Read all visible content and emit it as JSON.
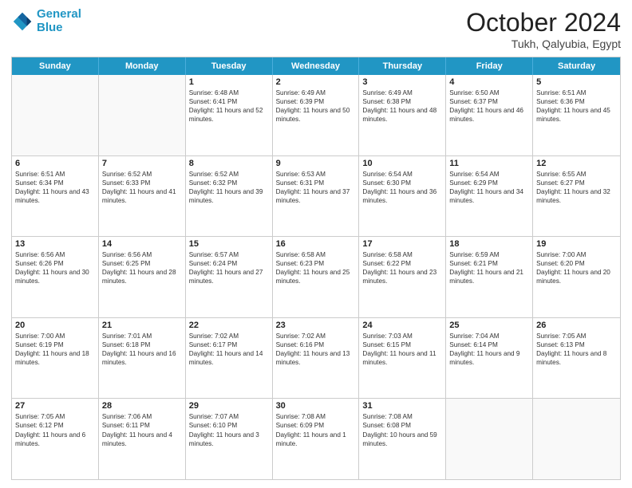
{
  "logo": {
    "line1": "General",
    "line2": "Blue"
  },
  "title": "October 2024",
  "location": "Tukh, Qalyubia, Egypt",
  "header_days": [
    "Sunday",
    "Monday",
    "Tuesday",
    "Wednesday",
    "Thursday",
    "Friday",
    "Saturday"
  ],
  "rows": [
    [
      {
        "day": "",
        "sunrise": "",
        "sunset": "",
        "daylight": "",
        "empty": true
      },
      {
        "day": "",
        "sunrise": "",
        "sunset": "",
        "daylight": "",
        "empty": true
      },
      {
        "day": "1",
        "sunrise": "Sunrise: 6:48 AM",
        "sunset": "Sunset: 6:41 PM",
        "daylight": "Daylight: 11 hours and 52 minutes."
      },
      {
        "day": "2",
        "sunrise": "Sunrise: 6:49 AM",
        "sunset": "Sunset: 6:39 PM",
        "daylight": "Daylight: 11 hours and 50 minutes."
      },
      {
        "day": "3",
        "sunrise": "Sunrise: 6:49 AM",
        "sunset": "Sunset: 6:38 PM",
        "daylight": "Daylight: 11 hours and 48 minutes."
      },
      {
        "day": "4",
        "sunrise": "Sunrise: 6:50 AM",
        "sunset": "Sunset: 6:37 PM",
        "daylight": "Daylight: 11 hours and 46 minutes."
      },
      {
        "day": "5",
        "sunrise": "Sunrise: 6:51 AM",
        "sunset": "Sunset: 6:36 PM",
        "daylight": "Daylight: 11 hours and 45 minutes."
      }
    ],
    [
      {
        "day": "6",
        "sunrise": "Sunrise: 6:51 AM",
        "sunset": "Sunset: 6:34 PM",
        "daylight": "Daylight: 11 hours and 43 minutes."
      },
      {
        "day": "7",
        "sunrise": "Sunrise: 6:52 AM",
        "sunset": "Sunset: 6:33 PM",
        "daylight": "Daylight: 11 hours and 41 minutes."
      },
      {
        "day": "8",
        "sunrise": "Sunrise: 6:52 AM",
        "sunset": "Sunset: 6:32 PM",
        "daylight": "Daylight: 11 hours and 39 minutes."
      },
      {
        "day": "9",
        "sunrise": "Sunrise: 6:53 AM",
        "sunset": "Sunset: 6:31 PM",
        "daylight": "Daylight: 11 hours and 37 minutes."
      },
      {
        "day": "10",
        "sunrise": "Sunrise: 6:54 AM",
        "sunset": "Sunset: 6:30 PM",
        "daylight": "Daylight: 11 hours and 36 minutes."
      },
      {
        "day": "11",
        "sunrise": "Sunrise: 6:54 AM",
        "sunset": "Sunset: 6:29 PM",
        "daylight": "Daylight: 11 hours and 34 minutes."
      },
      {
        "day": "12",
        "sunrise": "Sunrise: 6:55 AM",
        "sunset": "Sunset: 6:27 PM",
        "daylight": "Daylight: 11 hours and 32 minutes."
      }
    ],
    [
      {
        "day": "13",
        "sunrise": "Sunrise: 6:56 AM",
        "sunset": "Sunset: 6:26 PM",
        "daylight": "Daylight: 11 hours and 30 minutes."
      },
      {
        "day": "14",
        "sunrise": "Sunrise: 6:56 AM",
        "sunset": "Sunset: 6:25 PM",
        "daylight": "Daylight: 11 hours and 28 minutes."
      },
      {
        "day": "15",
        "sunrise": "Sunrise: 6:57 AM",
        "sunset": "Sunset: 6:24 PM",
        "daylight": "Daylight: 11 hours and 27 minutes."
      },
      {
        "day": "16",
        "sunrise": "Sunrise: 6:58 AM",
        "sunset": "Sunset: 6:23 PM",
        "daylight": "Daylight: 11 hours and 25 minutes."
      },
      {
        "day": "17",
        "sunrise": "Sunrise: 6:58 AM",
        "sunset": "Sunset: 6:22 PM",
        "daylight": "Daylight: 11 hours and 23 minutes."
      },
      {
        "day": "18",
        "sunrise": "Sunrise: 6:59 AM",
        "sunset": "Sunset: 6:21 PM",
        "daylight": "Daylight: 11 hours and 21 minutes."
      },
      {
        "day": "19",
        "sunrise": "Sunrise: 7:00 AM",
        "sunset": "Sunset: 6:20 PM",
        "daylight": "Daylight: 11 hours and 20 minutes."
      }
    ],
    [
      {
        "day": "20",
        "sunrise": "Sunrise: 7:00 AM",
        "sunset": "Sunset: 6:19 PM",
        "daylight": "Daylight: 11 hours and 18 minutes."
      },
      {
        "day": "21",
        "sunrise": "Sunrise: 7:01 AM",
        "sunset": "Sunset: 6:18 PM",
        "daylight": "Daylight: 11 hours and 16 minutes."
      },
      {
        "day": "22",
        "sunrise": "Sunrise: 7:02 AM",
        "sunset": "Sunset: 6:17 PM",
        "daylight": "Daylight: 11 hours and 14 minutes."
      },
      {
        "day": "23",
        "sunrise": "Sunrise: 7:02 AM",
        "sunset": "Sunset: 6:16 PM",
        "daylight": "Daylight: 11 hours and 13 minutes."
      },
      {
        "day": "24",
        "sunrise": "Sunrise: 7:03 AM",
        "sunset": "Sunset: 6:15 PM",
        "daylight": "Daylight: 11 hours and 11 minutes."
      },
      {
        "day": "25",
        "sunrise": "Sunrise: 7:04 AM",
        "sunset": "Sunset: 6:14 PM",
        "daylight": "Daylight: 11 hours and 9 minutes."
      },
      {
        "day": "26",
        "sunrise": "Sunrise: 7:05 AM",
        "sunset": "Sunset: 6:13 PM",
        "daylight": "Daylight: 11 hours and 8 minutes."
      }
    ],
    [
      {
        "day": "27",
        "sunrise": "Sunrise: 7:05 AM",
        "sunset": "Sunset: 6:12 PM",
        "daylight": "Daylight: 11 hours and 6 minutes."
      },
      {
        "day": "28",
        "sunrise": "Sunrise: 7:06 AM",
        "sunset": "Sunset: 6:11 PM",
        "daylight": "Daylight: 11 hours and 4 minutes."
      },
      {
        "day": "29",
        "sunrise": "Sunrise: 7:07 AM",
        "sunset": "Sunset: 6:10 PM",
        "daylight": "Daylight: 11 hours and 3 minutes."
      },
      {
        "day": "30",
        "sunrise": "Sunrise: 7:08 AM",
        "sunset": "Sunset: 6:09 PM",
        "daylight": "Daylight: 11 hours and 1 minute."
      },
      {
        "day": "31",
        "sunrise": "Sunrise: 7:08 AM",
        "sunset": "Sunset: 6:08 PM",
        "daylight": "Daylight: 10 hours and 59 minutes."
      },
      {
        "day": "",
        "sunrise": "",
        "sunset": "",
        "daylight": "",
        "empty": true
      },
      {
        "day": "",
        "sunrise": "",
        "sunset": "",
        "daylight": "",
        "empty": true
      }
    ]
  ]
}
